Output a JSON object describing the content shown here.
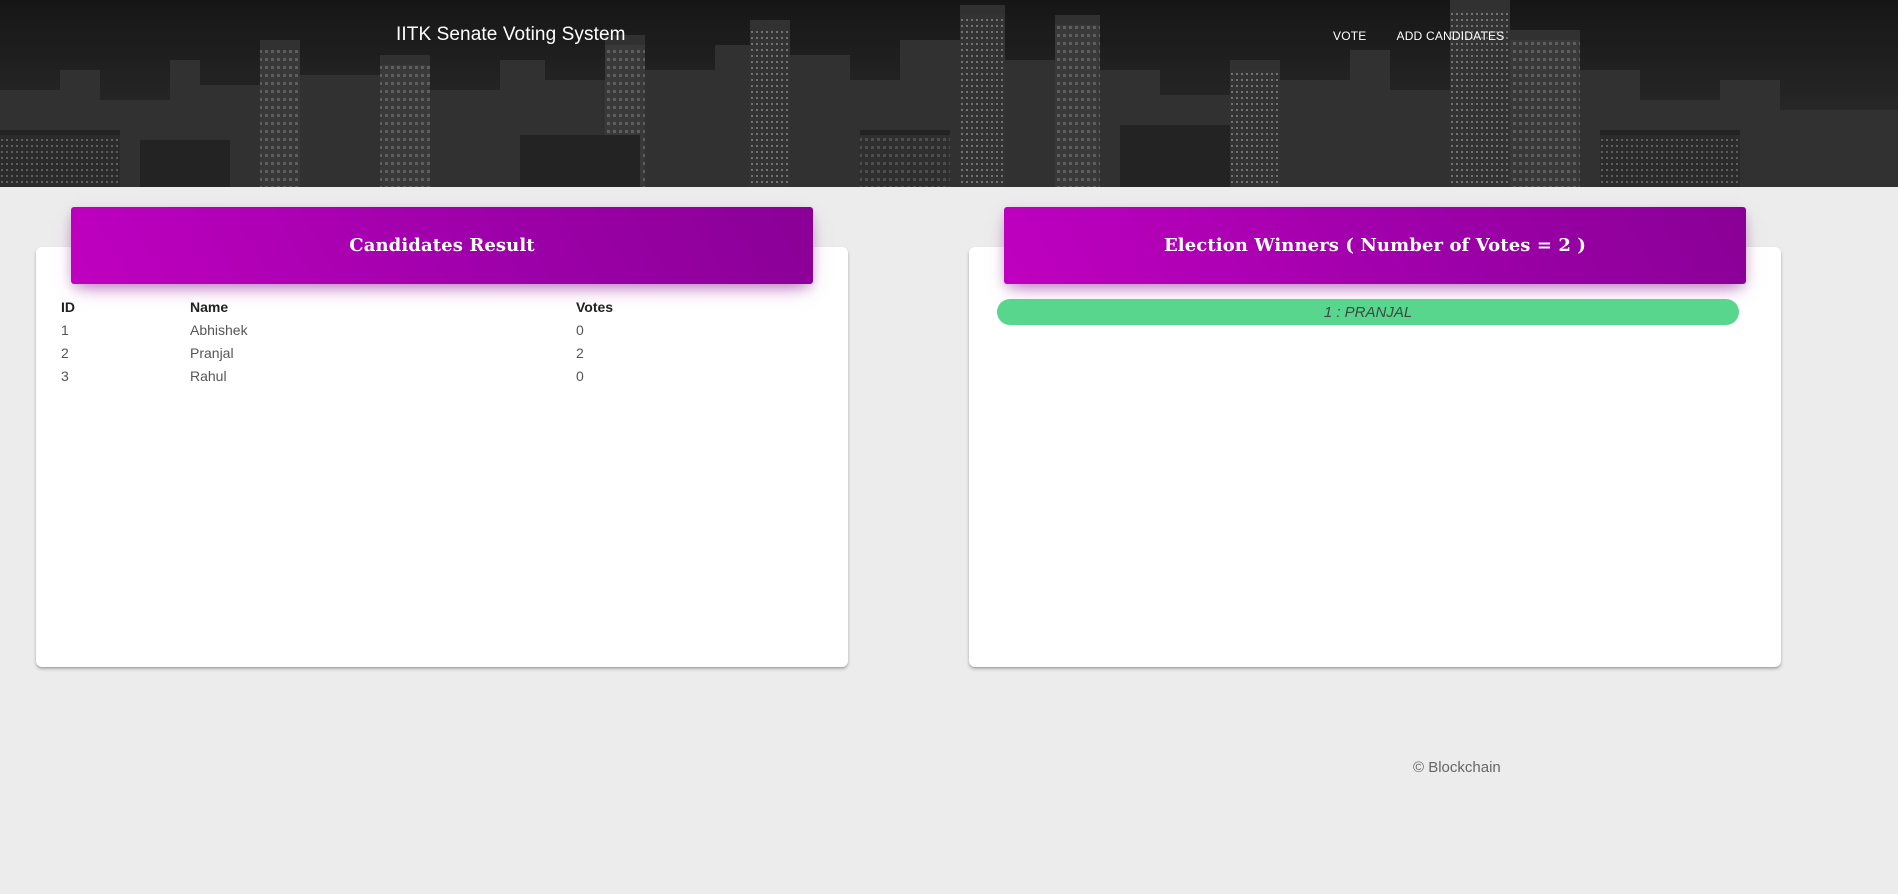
{
  "navbar": {
    "brand": "IITK Senate Voting System",
    "links": [
      "VOTE",
      "ADD CANDIDATES"
    ]
  },
  "results_card": {
    "title": "Candidates Result",
    "columns": [
      "ID",
      "Name",
      "Votes"
    ],
    "rows": [
      {
        "id": "1",
        "name": "Abhishek",
        "votes": "0"
      },
      {
        "id": "2",
        "name": "Pranjal",
        "votes": "2"
      },
      {
        "id": "3",
        "name": "Rahul",
        "votes": "0"
      }
    ]
  },
  "winners_card": {
    "title": "Election Winners ( Number of Votes = 2 )",
    "winners": [
      "1 : PRANJAL"
    ]
  },
  "footer": {
    "text": "© Blockchain"
  },
  "colors": {
    "card_header_gradient_start": "#c000c0",
    "card_header_gradient_end": "#8a0096",
    "winner_badge": "#58d68d",
    "page_background": "#ececec"
  }
}
